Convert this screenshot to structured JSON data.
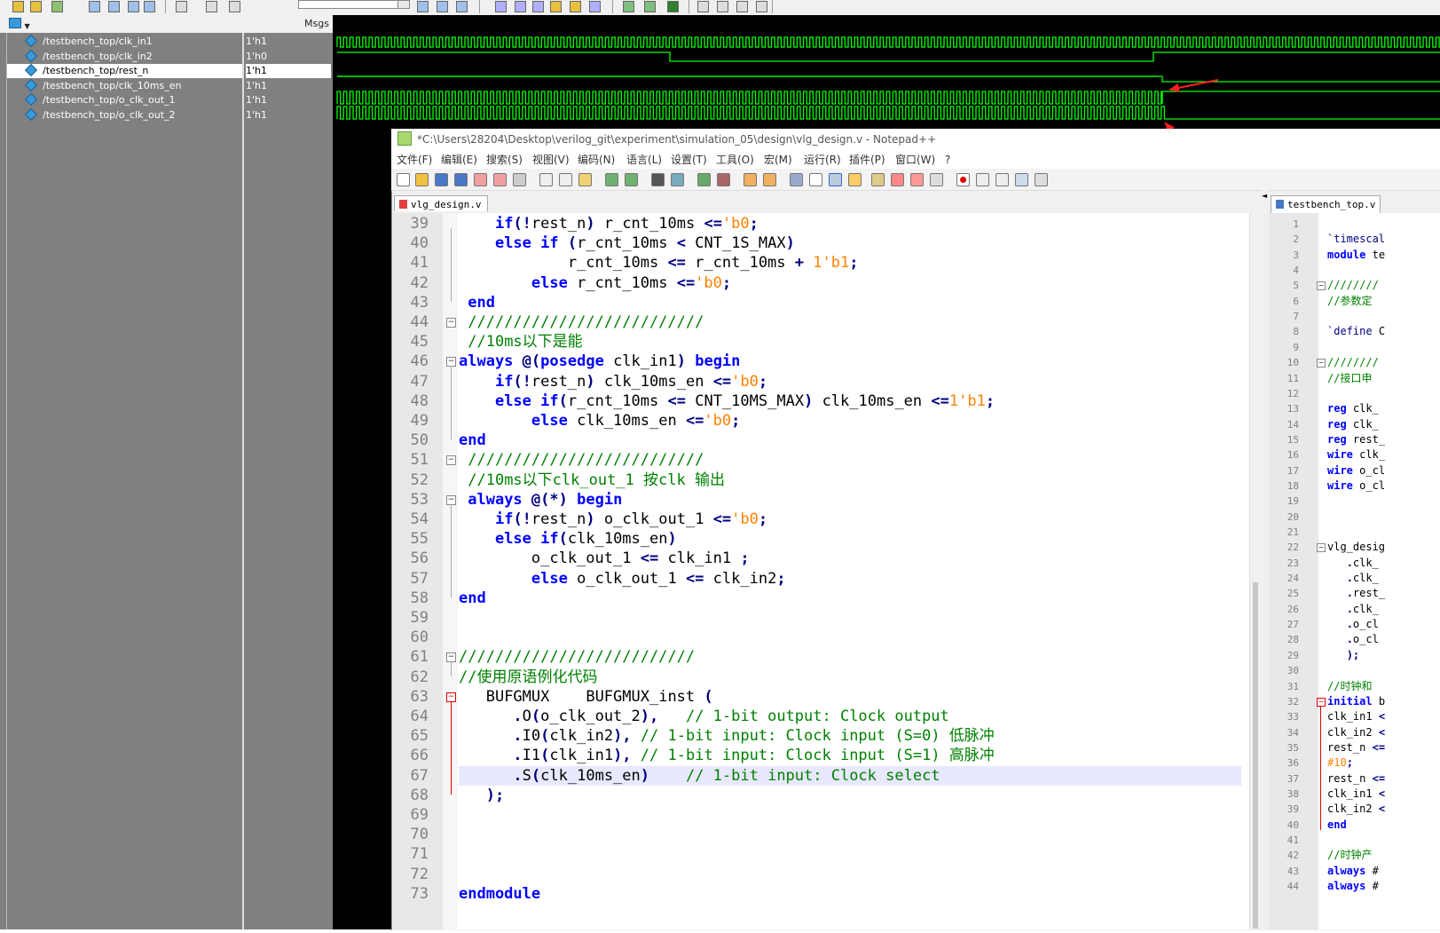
{
  "waves": {
    "header_msgs": "Msgs",
    "signals": [
      {
        "name": "/testbench_top/clk_in1",
        "value": "1'h1",
        "selected": false
      },
      {
        "name": "/testbench_top/clk_in2",
        "value": "1'h0",
        "selected": false
      },
      {
        "name": "/testbench_top/rest_n",
        "value": "1'h1",
        "selected": true
      },
      {
        "name": "/testbench_top/clk_10ms_en",
        "value": "1'h1",
        "selected": false
      },
      {
        "name": "/testbench_top/o_clk_out_1",
        "value": "1'h1",
        "selected": false
      },
      {
        "name": "/testbench_top/o_clk_out_2",
        "value": "1'h1",
        "selected": false
      }
    ],
    "colors": {
      "trace": "#00ff00",
      "background": "#000000",
      "arrow": "#ff2020"
    }
  },
  "notepad": {
    "title": "*C:\\Users\\28204\\Desktop\\verilog_git\\experiment\\simulation_05\\design\\vlg_design.v - Notepad++",
    "menu": [
      "文件(F)",
      "编辑(E)",
      "搜索(S)",
      "视图(V)",
      "编码(N)",
      "语言(L)",
      "设置(T)",
      "工具(O)",
      "宏(M)",
      "运行(R)",
      "插件(P)",
      "窗口(W)",
      "?"
    ],
    "tab_left": "vlg_design.v",
    "tab_right": "testbench_top.v",
    "left_lines": [
      {
        "n": "39",
        "t": "    if(!rest_n) r_cnt_10ms <='b0;"
      },
      {
        "n": "40",
        "t": "    else if (r_cnt_10ms < CNT_1S_MAX)"
      },
      {
        "n": "41",
        "t": "            r_cnt_10ms <= r_cnt_10ms + 1'b1;"
      },
      {
        "n": "42",
        "t": "        else r_cnt_10ms <='b0;"
      },
      {
        "n": "43",
        "t": " end"
      },
      {
        "n": "44",
        "t": " //////////////////////////"
      },
      {
        "n": "45",
        "t": " //10ms以下是能"
      },
      {
        "n": "46",
        "t": "always @(posedge clk_in1) begin"
      },
      {
        "n": "47",
        "t": "    if(!rest_n) clk_10ms_en <='b0;"
      },
      {
        "n": "48",
        "t": "    else if(r_cnt_10ms <= CNT_10MS_MAX) clk_10ms_en <=1'b1;"
      },
      {
        "n": "49",
        "t": "        else clk_10ms_en <='b0;"
      },
      {
        "n": "50",
        "t": "end"
      },
      {
        "n": "51",
        "t": " //////////////////////////"
      },
      {
        "n": "52",
        "t": " //10ms以下clk_out_1 按clk 输出"
      },
      {
        "n": "53",
        "t": " always @(*) begin"
      },
      {
        "n": "54",
        "t": "    if(!rest_n) o_clk_out_1 <='b0;"
      },
      {
        "n": "55",
        "t": "    else if(clk_10ms_en)"
      },
      {
        "n": "56",
        "t": "        o_clk_out_1 <= clk_in1 ;"
      },
      {
        "n": "57",
        "t": "        else o_clk_out_1 <= clk_in2;"
      },
      {
        "n": "58",
        "t": "end"
      },
      {
        "n": "59",
        "t": ""
      },
      {
        "n": "60",
        "t": ""
      },
      {
        "n": "61",
        "t": "//////////////////////////"
      },
      {
        "n": "62",
        "t": "//使用原语例化代码"
      },
      {
        "n": "63",
        "t": "   BUFGMUX    BUFGMUX_inst ("
      },
      {
        "n": "64",
        "t": "      .O(o_clk_out_2),   // 1-bit output: Clock output"
      },
      {
        "n": "65",
        "t": "      .I0(clk_in2), // 1-bit input: Clock input (S=0) 低脉冲"
      },
      {
        "n": "66",
        "t": "      .I1(clk_in1), // 1-bit input: Clock input (S=1) 高脉冲"
      },
      {
        "n": "67",
        "t": "      .S(clk_10ms_en)    // 1-bit input: Clock select"
      },
      {
        "n": "68",
        "t": "   );"
      },
      {
        "n": "69",
        "t": ""
      },
      {
        "n": "70",
        "t": ""
      },
      {
        "n": "71",
        "t": ""
      },
      {
        "n": "72",
        "t": ""
      },
      {
        "n": "73",
        "t": "endmodule"
      }
    ],
    "right_lines": [
      {
        "n": "1",
        "t": ""
      },
      {
        "n": "2",
        "t": "`timescal"
      },
      {
        "n": "3",
        "t": "module te"
      },
      {
        "n": "4",
        "t": ""
      },
      {
        "n": "5",
        "t": "////////"
      },
      {
        "n": "6",
        "t": "//参数定"
      },
      {
        "n": "7",
        "t": ""
      },
      {
        "n": "8",
        "t": "`define C"
      },
      {
        "n": "9",
        "t": ""
      },
      {
        "n": "10",
        "t": "////////"
      },
      {
        "n": "11",
        "t": "//接口申"
      },
      {
        "n": "12",
        "t": ""
      },
      {
        "n": "13",
        "t": "reg clk_"
      },
      {
        "n": "14",
        "t": "reg clk_"
      },
      {
        "n": "15",
        "t": "reg rest_"
      },
      {
        "n": "16",
        "t": "wire clk_"
      },
      {
        "n": "17",
        "t": "wire o_cl"
      },
      {
        "n": "18",
        "t": "wire o_cl"
      },
      {
        "n": "19",
        "t": ""
      },
      {
        "n": "20",
        "t": ""
      },
      {
        "n": "21",
        "t": ""
      },
      {
        "n": "22",
        "t": "vlg_desig"
      },
      {
        "n": "23",
        "t": "   .clk_"
      },
      {
        "n": "24",
        "t": "   .clk_"
      },
      {
        "n": "25",
        "t": "   .rest_"
      },
      {
        "n": "26",
        "t": "   .clk_"
      },
      {
        "n": "27",
        "t": "   .o_cl"
      },
      {
        "n": "28",
        "t": "   .o_cl"
      },
      {
        "n": "29",
        "t": "   );"
      },
      {
        "n": "30",
        "t": ""
      },
      {
        "n": "31",
        "t": "//时钟和"
      },
      {
        "n": "32",
        "t": "initial b"
      },
      {
        "n": "33",
        "t": "clk_in1 <"
      },
      {
        "n": "34",
        "t": "clk_in2 <"
      },
      {
        "n": "35",
        "t": "rest_n <="
      },
      {
        "n": "36",
        "t": "#10;"
      },
      {
        "n": "37",
        "t": "rest_n <="
      },
      {
        "n": "38",
        "t": "clk_in1 <"
      },
      {
        "n": "39",
        "t": "clk_in2 <"
      },
      {
        "n": "40",
        "t": "end"
      },
      {
        "n": "41",
        "t": ""
      },
      {
        "n": "42",
        "t": "//时钟产"
      },
      {
        "n": "43",
        "t": "always #"
      },
      {
        "n": "44",
        "t": "always #"
      }
    ]
  }
}
